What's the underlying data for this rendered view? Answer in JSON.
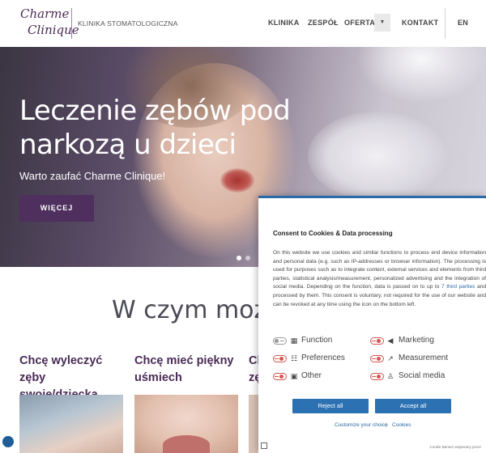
{
  "header": {
    "logo_line1": "Charme",
    "logo_line2": "Clinique",
    "tagline": "KLINIKA STOMATOLOGICZNA",
    "nav": [
      {
        "label": "KLINIKA"
      },
      {
        "label": "ZESPÓŁ"
      },
      {
        "label": "OFERTA"
      },
      {
        "label": "KONTAKT"
      }
    ],
    "dropdown_icon": "▼",
    "lang": "EN"
  },
  "hero": {
    "title": "Leczenie zębów pod narkozą u dzieci",
    "subtitle": "Warto zaufać Charme Clinique!",
    "button": "WIĘCEJ"
  },
  "section": {
    "title": "W czym możemy",
    "cards": [
      {
        "title": "Chcę wyleczyć zęby swoje/dziecka"
      },
      {
        "title": "Chcę mieć piękny uśmiech"
      },
      {
        "title": "Ch zę"
      }
    ]
  },
  "cookie": {
    "title": "Consent to Cookies & Data processing",
    "body_before_link": "On this website we use cookies and similar functions to process end device information and personal data (e.g. such as IP-addresses or browser information). The processing is used for purposes such as to integrate content, external services and elements from third parties, statistical analysis/measurement, personalized advertising and the integration of social media. Depending on the function, data is passed on to up to ",
    "link_text": "7 third parties",
    "body_after_link": " and processed by them. This consent is voluntary, not required for the use of our website and can be revoked at any time using the icon on the bottom left.",
    "categories": [
      {
        "label": "Function",
        "icon": "grid-icon"
      },
      {
        "label": "Marketing",
        "icon": "megaphone-icon"
      },
      {
        "label": "Preferences",
        "icon": "sliders-icon"
      },
      {
        "label": "Measurement",
        "icon": "chart-icon"
      },
      {
        "label": "Other",
        "icon": "dots-icon"
      },
      {
        "label": "Social media",
        "icon": "thumbs-up-icon"
      }
    ],
    "reject": "Reject all",
    "accept": "Accept all",
    "customize": "Customize your choice",
    "separator": "|",
    "cookies_link": "Cookies",
    "footer": "Cookie Banner wspierany przez"
  },
  "colors": {
    "brand_purple": "#4e2f5d",
    "button_blue": "#2c72b3",
    "toggle_red": "#d9534f"
  }
}
